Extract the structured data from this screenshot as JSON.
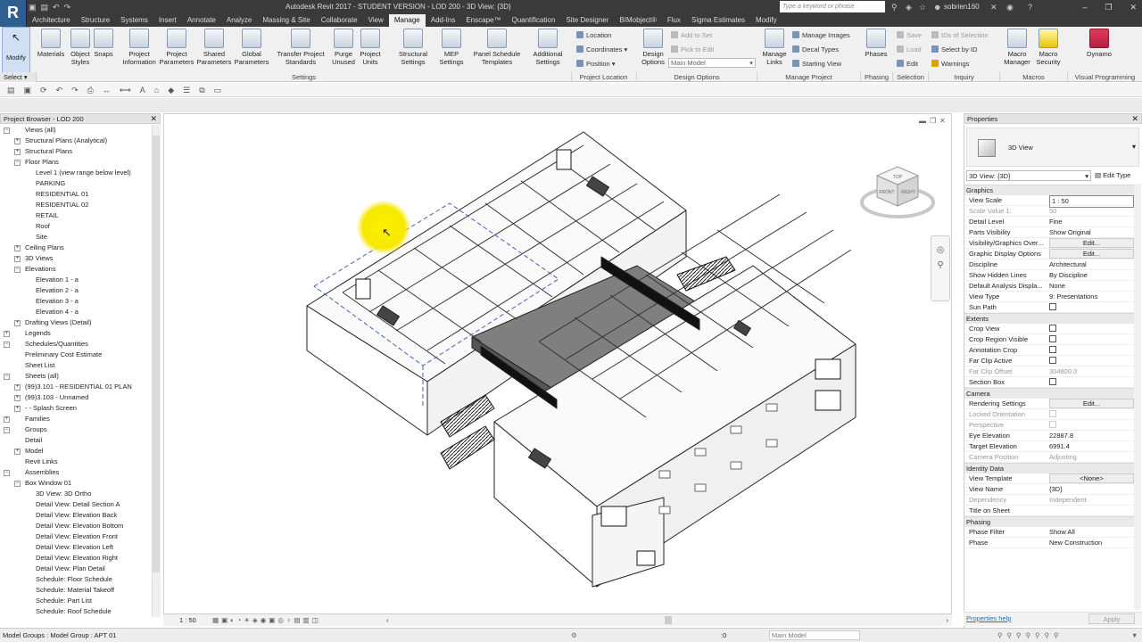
{
  "app": {
    "title": "Autodesk Revit 2017 - STUDENT VERSION -    LOD 200 - 3D View: {3D}",
    "logo": "R",
    "search_placeholder": "Type a keyword or phrase",
    "user": "sobrien160"
  },
  "tabs": [
    "Architecture",
    "Structure",
    "Systems",
    "Insert",
    "Annotate",
    "Analyze",
    "Massing & Site",
    "Collaborate",
    "View",
    "Manage",
    "Add-Ins",
    "Enscape™",
    "Quantification",
    "Site Designer",
    "BIMobject®",
    "Flux",
    "Sigma Estimates",
    "Modify"
  ],
  "active_tab": "Manage",
  "ribbon": {
    "modify": "Modify",
    "select": "Select ▾",
    "settings_buttons": [
      {
        "label": "Materials"
      },
      {
        "label": "Object Styles"
      },
      {
        "label": "Snaps"
      },
      {
        "label": "Project Information"
      },
      {
        "label": "Project Parameters"
      },
      {
        "label": "Shared Parameters"
      },
      {
        "label": "Global Parameters"
      },
      {
        "label": "Transfer Project Standards"
      },
      {
        "label": "Purge Unused"
      },
      {
        "label": "Project Units"
      },
      {
        "label": "Structural Settings"
      },
      {
        "label": "MEP Settings"
      },
      {
        "label": "Panel Schedule Templates"
      },
      {
        "label": "Additional Settings"
      }
    ],
    "location_items": [
      "Location",
      "Coordinates ▾",
      "Position ▾"
    ],
    "design_options_button": "Design Options",
    "design_options_items": [
      "Add to Set",
      "Pick to Edit"
    ],
    "design_option_value": "Main Model",
    "manage_links": "Manage Links",
    "manage_project_items": [
      "Manage Images",
      "Decal Types",
      "Starting View"
    ],
    "phases": "Phases",
    "selection_items": [
      "Save",
      "Load",
      "Edit"
    ],
    "inquiry_items": [
      "IDs of Selection",
      "Select by ID",
      "Warnings"
    ],
    "macro_manager": "Macro Manager",
    "macro_security": "Macro Security",
    "dynamo": "Dynamo",
    "panels": [
      "Settings",
      "Project Location",
      "Design Options",
      "Manage Project",
      "Phasing",
      "Selection",
      "Inquiry",
      "Macros",
      "Visual Programming"
    ]
  },
  "project_browser": {
    "title": "Project Browser - LOD 200",
    "items": [
      {
        "label": "Views (all)",
        "level": 0,
        "toggle": "−"
      },
      {
        "label": "Structural Plans (Analytical)",
        "level": 1,
        "toggle": "+"
      },
      {
        "label": "Structural Plans",
        "level": 1,
        "toggle": "+"
      },
      {
        "label": "Floor Plans",
        "level": 1,
        "toggle": "−"
      },
      {
        "label": "Level 1 (view range below level)",
        "level": 2,
        "toggle": ""
      },
      {
        "label": "PARKING",
        "level": 2,
        "toggle": ""
      },
      {
        "label": "RESIDENTIAL 01",
        "level": 2,
        "toggle": ""
      },
      {
        "label": "RESIDENTIAL 02",
        "level": 2,
        "toggle": ""
      },
      {
        "label": "RETAIL",
        "level": 2,
        "toggle": ""
      },
      {
        "label": "Roof",
        "level": 2,
        "toggle": ""
      },
      {
        "label": "Site",
        "level": 2,
        "toggle": ""
      },
      {
        "label": "Ceiling Plans",
        "level": 1,
        "toggle": "+"
      },
      {
        "label": "3D Views",
        "level": 1,
        "toggle": "+"
      },
      {
        "label": "Elevations",
        "level": 1,
        "toggle": "−"
      },
      {
        "label": "Elevation 1 - a",
        "level": 2,
        "toggle": ""
      },
      {
        "label": "Elevation 2 - a",
        "level": 2,
        "toggle": ""
      },
      {
        "label": "Elevation 3 - a",
        "level": 2,
        "toggle": ""
      },
      {
        "label": "Elevation 4 - a",
        "level": 2,
        "toggle": ""
      },
      {
        "label": "Drafting Views (Detail)",
        "level": 1,
        "toggle": "+"
      },
      {
        "label": "Legends",
        "level": 0,
        "toggle": "+"
      },
      {
        "label": "Schedules/Quantities",
        "level": 0,
        "toggle": "−"
      },
      {
        "label": "Preliminary Cost Estimate",
        "level": 1,
        "toggle": ""
      },
      {
        "label": "Sheet List",
        "level": 1,
        "toggle": ""
      },
      {
        "label": "Sheets (all)",
        "level": 0,
        "toggle": "−"
      },
      {
        "label": "(99)3.101 - RESIDENTIAL 01 PLAN",
        "level": 1,
        "toggle": "+"
      },
      {
        "label": "(99)3.103 - Unnamed",
        "level": 1,
        "toggle": "+"
      },
      {
        "label": "- - Splash Screen",
        "level": 1,
        "toggle": "+"
      },
      {
        "label": "Families",
        "level": 0,
        "toggle": "+"
      },
      {
        "label": "Groups",
        "level": 0,
        "toggle": "−"
      },
      {
        "label": "Detail",
        "level": 1,
        "toggle": ""
      },
      {
        "label": "Model",
        "level": 1,
        "toggle": "+"
      },
      {
        "label": "Revit Links",
        "level": 0,
        "toggle": ""
      },
      {
        "label": "Assemblies",
        "level": 0,
        "toggle": "−"
      },
      {
        "label": "Box Window 01",
        "level": 1,
        "toggle": "−"
      },
      {
        "label": "3D View: 3D Ortho",
        "level": 2,
        "toggle": ""
      },
      {
        "label": "Detail View: Detail Section A",
        "level": 2,
        "toggle": ""
      },
      {
        "label": "Detail View: Elevation Back",
        "level": 2,
        "toggle": ""
      },
      {
        "label": "Detail View: Elevation Bottom",
        "level": 2,
        "toggle": ""
      },
      {
        "label": "Detail View: Elevation Front",
        "level": 2,
        "toggle": ""
      },
      {
        "label": "Detail View: Elevation Left",
        "level": 2,
        "toggle": ""
      },
      {
        "label": "Detail View: Elevation Right",
        "level": 2,
        "toggle": ""
      },
      {
        "label": "Detail View: Plan Detail",
        "level": 2,
        "toggle": ""
      },
      {
        "label": "Schedule: Floor Schedule",
        "level": 2,
        "toggle": ""
      },
      {
        "label": "Schedule: Material Takeoff",
        "level": 2,
        "toggle": ""
      },
      {
        "label": "Schedule: Part List",
        "level": 2,
        "toggle": ""
      },
      {
        "label": "Schedule: Roof Schedule",
        "level": 2,
        "toggle": ""
      }
    ]
  },
  "view": {
    "scale": "1 : 50",
    "viewcube_top": "TOP",
    "viewcube_front": "FRONT",
    "viewcube_right": "RIGHT"
  },
  "properties": {
    "title": "Properties",
    "type_name": "3D View",
    "view_selector": "3D View: {3D}",
    "edit_type": "Edit Type",
    "sections": [
      {
        "name": "Graphics",
        "rows": [
          {
            "k": "View Scale",
            "v": "1 : 50",
            "kind": "input"
          },
          {
            "k": "Scale Value    1:",
            "v": "50",
            "kind": "dim"
          },
          {
            "k": "Detail Level",
            "v": "Fine",
            "kind": "text"
          },
          {
            "k": "Parts Visibility",
            "v": "Show Original",
            "kind": "text"
          },
          {
            "k": "Visibility/Graphics Over...",
            "v": "Edit...",
            "kind": "button"
          },
          {
            "k": "Graphic Display Options",
            "v": "Edit...",
            "kind": "button"
          },
          {
            "k": "Discipline",
            "v": "Architectural",
            "kind": "text"
          },
          {
            "k": "Show Hidden Lines",
            "v": "By Discipline",
            "kind": "text"
          },
          {
            "k": "Default Analysis Displa...",
            "v": "None",
            "kind": "text"
          },
          {
            "k": "View Type",
            "v": "9: Presentations",
            "kind": "text"
          },
          {
            "k": "Sun Path",
            "v": "",
            "kind": "check"
          }
        ]
      },
      {
        "name": "Extents",
        "rows": [
          {
            "k": "Crop View",
            "v": "",
            "kind": "check"
          },
          {
            "k": "Crop Region Visible",
            "v": "",
            "kind": "check"
          },
          {
            "k": "Annotation Crop",
            "v": "",
            "kind": "check"
          },
          {
            "k": "Far Clip Active",
            "v": "",
            "kind": "check"
          },
          {
            "k": "Far Clip Offset",
            "v": "304800.0",
            "kind": "dim"
          },
          {
            "k": "Section Box",
            "v": "",
            "kind": "check"
          }
        ]
      },
      {
        "name": "Camera",
        "rows": [
          {
            "k": "Rendering Settings",
            "v": "Edit...",
            "kind": "button"
          },
          {
            "k": "Locked Orientation",
            "v": "",
            "kind": "dimcheck"
          },
          {
            "k": "Perspective",
            "v": "",
            "kind": "dimcheck"
          },
          {
            "k": "Eye Elevation",
            "v": "22887.8",
            "kind": "text"
          },
          {
            "k": "Target Elevation",
            "v": "6991.4",
            "kind": "text"
          },
          {
            "k": "Camera Position",
            "v": "Adjusting",
            "kind": "dim"
          }
        ]
      },
      {
        "name": "Identity Data",
        "rows": [
          {
            "k": "View Template",
            "v": "<None>",
            "kind": "button"
          },
          {
            "k": "View Name",
            "v": "{3D}",
            "kind": "text"
          },
          {
            "k": "Dependency",
            "v": "Independent",
            "kind": "dim"
          },
          {
            "k": "Title on Sheet",
            "v": "",
            "kind": "text"
          }
        ]
      },
      {
        "name": "Phasing",
        "rows": [
          {
            "k": "Phase Filter",
            "v": "Show All",
            "kind": "text"
          },
          {
            "k": "Phase",
            "v": "New Construction",
            "kind": "text"
          }
        ]
      }
    ],
    "help_link": "Properties help",
    "apply": "Apply"
  },
  "status": {
    "message": "Model Groups : Model Group : APT 01",
    "zero": ":0",
    "model": "Main Model"
  },
  "colors": {
    "titlebar": "#3a3a3a",
    "ribbon": "#f0f0f0",
    "link": "#2a6ebb",
    "pointer": "#f6e800"
  }
}
